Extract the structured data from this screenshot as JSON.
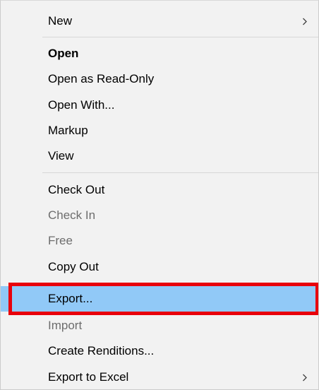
{
  "menu": {
    "items": [
      {
        "label": "New",
        "bold": false,
        "disabled": false,
        "submenu": true
      },
      {
        "label": "Open",
        "bold": true,
        "disabled": false,
        "submenu": false
      },
      {
        "label": "Open as Read-Only",
        "bold": false,
        "disabled": false,
        "submenu": false
      },
      {
        "label": "Open With...",
        "bold": false,
        "disabled": false,
        "submenu": false
      },
      {
        "label": "Markup",
        "bold": false,
        "disabled": false,
        "submenu": false
      },
      {
        "label": "View",
        "bold": false,
        "disabled": false,
        "submenu": false
      },
      {
        "label": "Check Out",
        "bold": false,
        "disabled": false,
        "submenu": false
      },
      {
        "label": "Check In",
        "bold": false,
        "disabled": true,
        "submenu": false
      },
      {
        "label": "Free",
        "bold": false,
        "disabled": true,
        "submenu": false
      },
      {
        "label": "Copy Out",
        "bold": false,
        "disabled": false,
        "submenu": false
      },
      {
        "label": "Export...",
        "bold": false,
        "disabled": false,
        "submenu": false,
        "highlighted": true
      },
      {
        "label": "Import",
        "bold": false,
        "disabled": true,
        "submenu": false
      },
      {
        "label": "Create Renditions...",
        "bold": false,
        "disabled": false,
        "submenu": false
      },
      {
        "label": "Export to Excel",
        "bold": false,
        "disabled": false,
        "submenu": true
      }
    ],
    "colors": {
      "background": "#f2f2f2",
      "highlight": "#91c9f7",
      "highlight_outline": "#e8000b",
      "disabled_text": "#6d6d6d"
    }
  }
}
